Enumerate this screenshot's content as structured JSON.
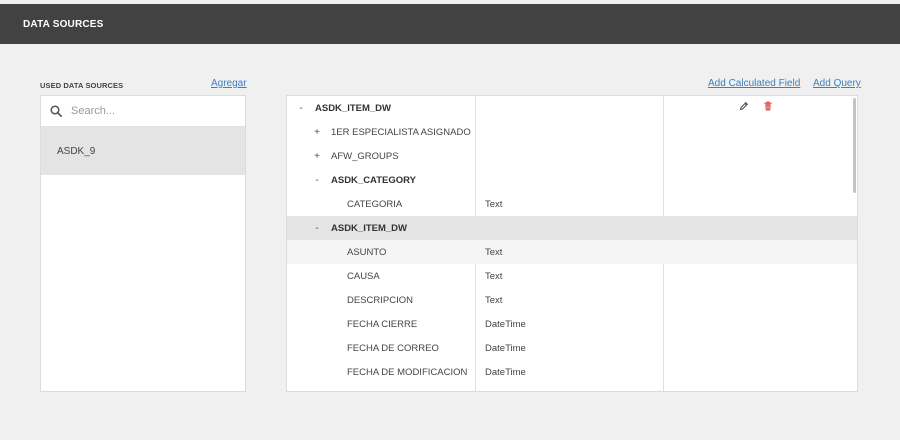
{
  "header": {
    "title": "DATA SOURCES"
  },
  "sidebar": {
    "label": "USED DATA SOURCES",
    "add_link": "Agregar",
    "search_placeholder": "Search...",
    "items": [
      {
        "label": "ASDK_9"
      }
    ]
  },
  "toolbar": {
    "add_calculated_field": "Add Calculated Field",
    "add_query": "Add Query"
  },
  "tree": {
    "rows": [
      {
        "expander": "-",
        "name": "ASDK_ITEM_DW",
        "type": ""
      },
      {
        "expander": "+",
        "name": "1ER ESPECIALISTA ASIGNADO",
        "type": ""
      },
      {
        "expander": "+",
        "name": "AFW_GROUPS",
        "type": ""
      },
      {
        "expander": "-",
        "name": "ASDK_CATEGORY",
        "type": ""
      },
      {
        "expander": "",
        "name": "CATEGORIA",
        "type": "Text"
      },
      {
        "expander": "-",
        "name": "ASDK_ITEM_DW",
        "type": ""
      },
      {
        "expander": "",
        "name": "ASUNTO",
        "type": "Text"
      },
      {
        "expander": "",
        "name": "CAUSA",
        "type": "Text"
      },
      {
        "expander": "",
        "name": "DESCRIPCION",
        "type": "Text"
      },
      {
        "expander": "",
        "name": "FECHA CIERRE",
        "type": "DateTime"
      },
      {
        "expander": "",
        "name": "FECHA DE CORREO",
        "type": "DateTime"
      },
      {
        "expander": "",
        "name": "FECHA DE MODIFICACION",
        "type": "DateTime"
      }
    ]
  },
  "icons": {
    "edit": "pencil-icon",
    "delete": "trash-icon",
    "search": "search-icon"
  },
  "colors": {
    "header_bg": "#424242",
    "link": "#3c7fc1",
    "delete": "#e03a3a",
    "selected_row": "#e4e4e4"
  }
}
